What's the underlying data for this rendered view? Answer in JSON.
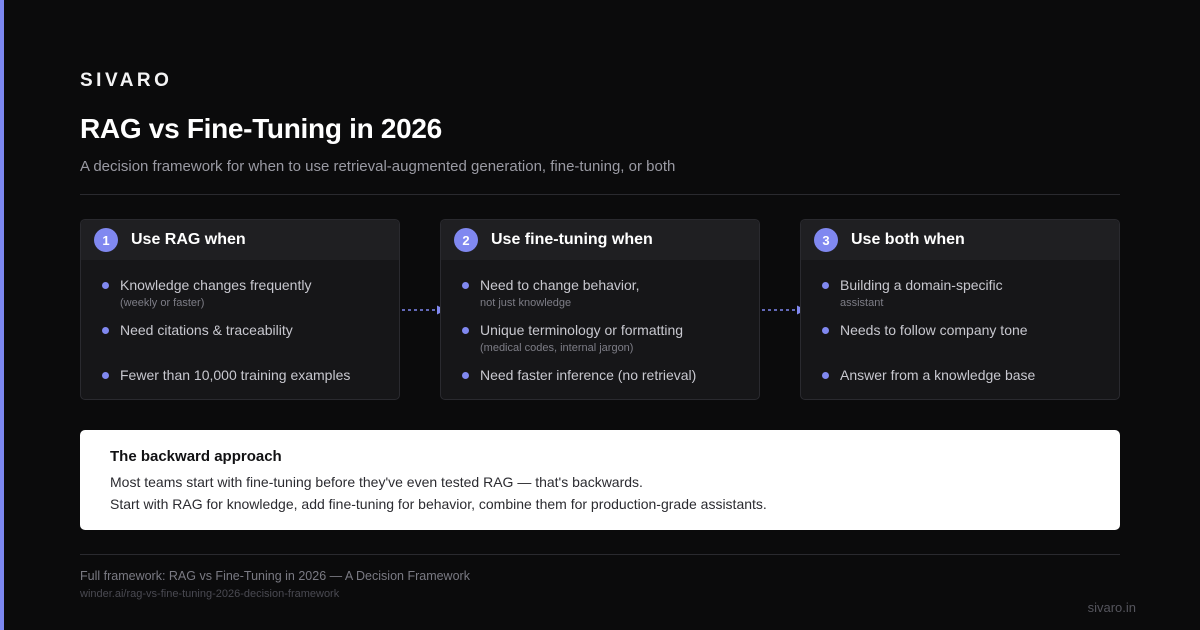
{
  "brand": "SIVARO",
  "title": "RAG vs Fine-Tuning in 2026",
  "subtitle": "A decision framework for when to use retrieval-augmented generation, fine-tuning, or both",
  "accent_color": "#8088f0",
  "cards": [
    {
      "number": "1",
      "title": "Use RAG when",
      "items": [
        {
          "text": "Knowledge changes frequently",
          "sub": "(weekly or faster)"
        },
        {
          "text": "Need citations & traceability",
          "sub": ""
        },
        {
          "text": "Fewer than 10,000 training examples",
          "sub": ""
        }
      ]
    },
    {
      "number": "2",
      "title": "Use fine-tuning when",
      "items": [
        {
          "text": "Need to change behavior,",
          "sub": "not just knowledge"
        },
        {
          "text": "Unique terminology or formatting",
          "sub": "(medical codes, internal jargon)"
        },
        {
          "text": "Need faster inference (no retrieval)",
          "sub": ""
        }
      ]
    },
    {
      "number": "3",
      "title": "Use both when",
      "items": [
        {
          "text": "Building a domain-specific",
          "sub": "assistant"
        },
        {
          "text": "Needs to follow company tone",
          "sub": ""
        },
        {
          "text": "Answer from a knowledge base",
          "sub": ""
        }
      ]
    }
  ],
  "callout": {
    "title": "The backward approach",
    "line1": "Most teams start with fine-tuning before they've even tested RAG — that's backwards.",
    "line2": "Start with RAG for knowledge, add fine-tuning for behavior, combine them for production-grade assistants."
  },
  "footer": {
    "main": "Full framework: RAG vs Fine-Tuning in 2026 — A Decision Framework",
    "url": "winder.ai/rag-vs-fine-tuning-2026-decision-framework",
    "domain": "sivaro.in"
  }
}
